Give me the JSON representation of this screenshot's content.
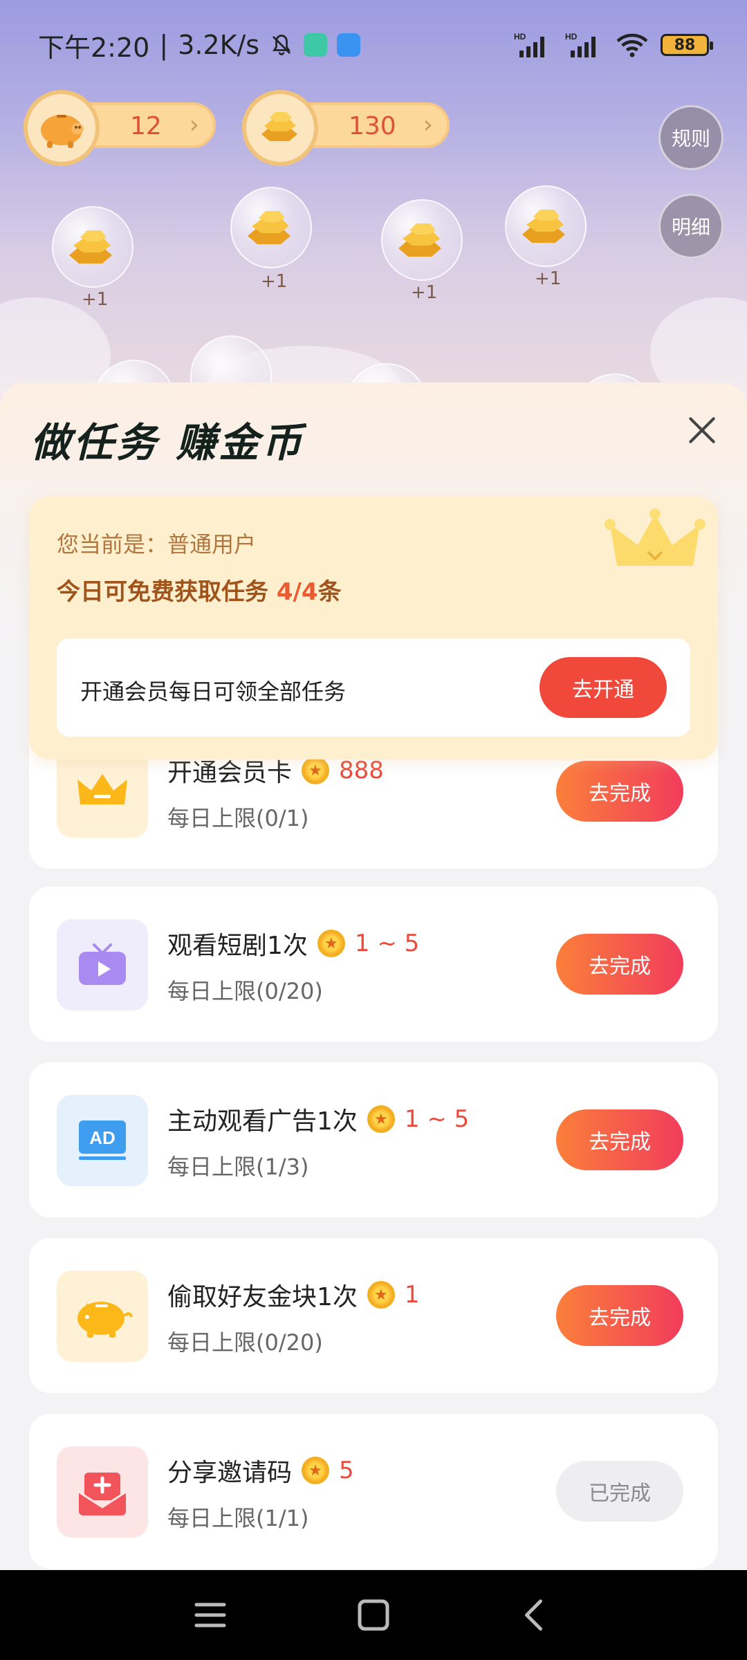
{
  "status_bar": {
    "time": "下午2:20",
    "net_speed": "3.2K/s",
    "signal1": "HD",
    "signal2": "HD",
    "battery": "88"
  },
  "counters": {
    "piggy_value": "12",
    "gold_value": "130"
  },
  "side_buttons": {
    "rules": "规则",
    "details": "明细"
  },
  "bubbles": [
    "+1",
    "+1",
    "+1",
    "+1"
  ],
  "sheet": {
    "title": "做任务  赚金币"
  },
  "member": {
    "status": "您当前是：普通用户",
    "quota_prefix": "今日可免费获取任务 ",
    "quota_count": "4/4",
    "quota_suffix": "条",
    "banner_text": "开通会员每日可领全部任务",
    "open_button": "去开通"
  },
  "tasks": [
    {
      "name": "开通会员卡",
      "reward": "888",
      "limit": "每日上限(0/1)",
      "button": "去完成",
      "icon": "crown-icon",
      "icon_bg": "#fff1d6"
    },
    {
      "name": "观看短剧1次",
      "reward": "1 ~ 5",
      "limit": "每日上限(0/20)",
      "button": "去完成",
      "icon": "tv-play-icon",
      "icon_bg": "#efecfb"
    },
    {
      "name": "主动观看广告1次",
      "reward": "1 ~ 5",
      "limit": "每日上限(1/3)",
      "button": "去完成",
      "icon": "ad-icon",
      "icon_bg": "#e4f1fc"
    },
    {
      "name": "偷取好友金块1次",
      "reward": "1",
      "limit": "每日上限(0/20)",
      "button": "去完成",
      "icon": "piggy-icon",
      "icon_bg": "#fff1d6"
    },
    {
      "name": "分享邀请码",
      "reward": "5",
      "limit": "每日上限(1/1)",
      "button": "已完成",
      "icon": "share-gift-icon",
      "icon_bg": "#fde5e5"
    }
  ],
  "colors": {
    "accent_red": "#f0493c",
    "reward_red": "#ea4b3c",
    "button_gradient_start": "#fb7f3a",
    "button_gradient_end": "#f13d5c",
    "member_card_bg": "#fef0cf"
  }
}
